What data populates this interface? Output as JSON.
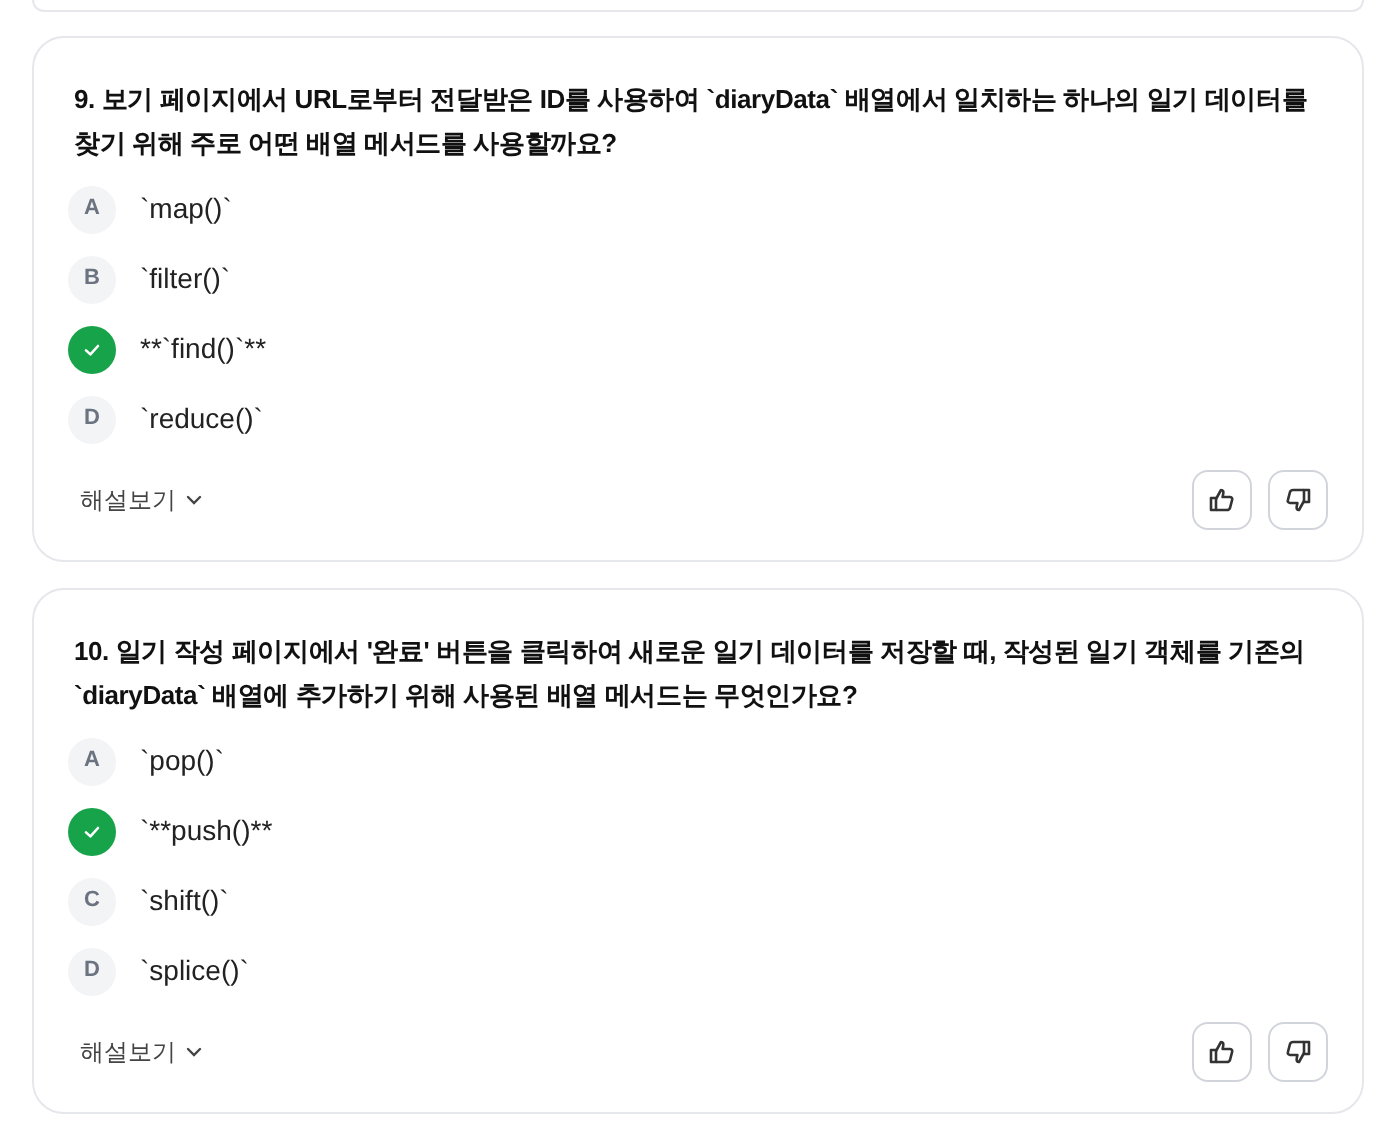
{
  "questions": [
    {
      "number": "9.",
      "text": "보기 페이지에서 URL로부터 전달받은 ID를 사용하여 `diaryData` 배열에서 일치하는 하나의 일기 데이터를 찾기 위해 주로 어떤 배열 메서드를 사용할까요?",
      "options": [
        {
          "label": "A",
          "text": "`map()`",
          "correct": false
        },
        {
          "label": "B",
          "text": "`filter()`",
          "correct": false
        },
        {
          "text": "**`find()`**",
          "correct": true
        },
        {
          "label": "D",
          "text": "`reduce()`",
          "correct": false
        }
      ],
      "explanation": {
        "label": "해설보기",
        "expanded": false
      }
    },
    {
      "number": "10.",
      "text": "일기 작성 페이지에서 '완료' 버튼을 클릭하여 새로운 일기 데이터를 저장할 때, 작성된 일기 객체를 기존의 `diaryData` 배열에 추가하기 위해 사용된 배열 메서드는 무엇인가요?",
      "options": [
        {
          "label": "A",
          "text": "`pop()`",
          "correct": false
        },
        {
          "text": "`**push()**",
          "correct": true
        },
        {
          "label": "C",
          "text": "`shift()`",
          "correct": false
        },
        {
          "label": "D",
          "text": "`splice()`",
          "correct": false
        }
      ],
      "explanation": {
        "label": "해설보기",
        "expanded": false
      }
    }
  ]
}
